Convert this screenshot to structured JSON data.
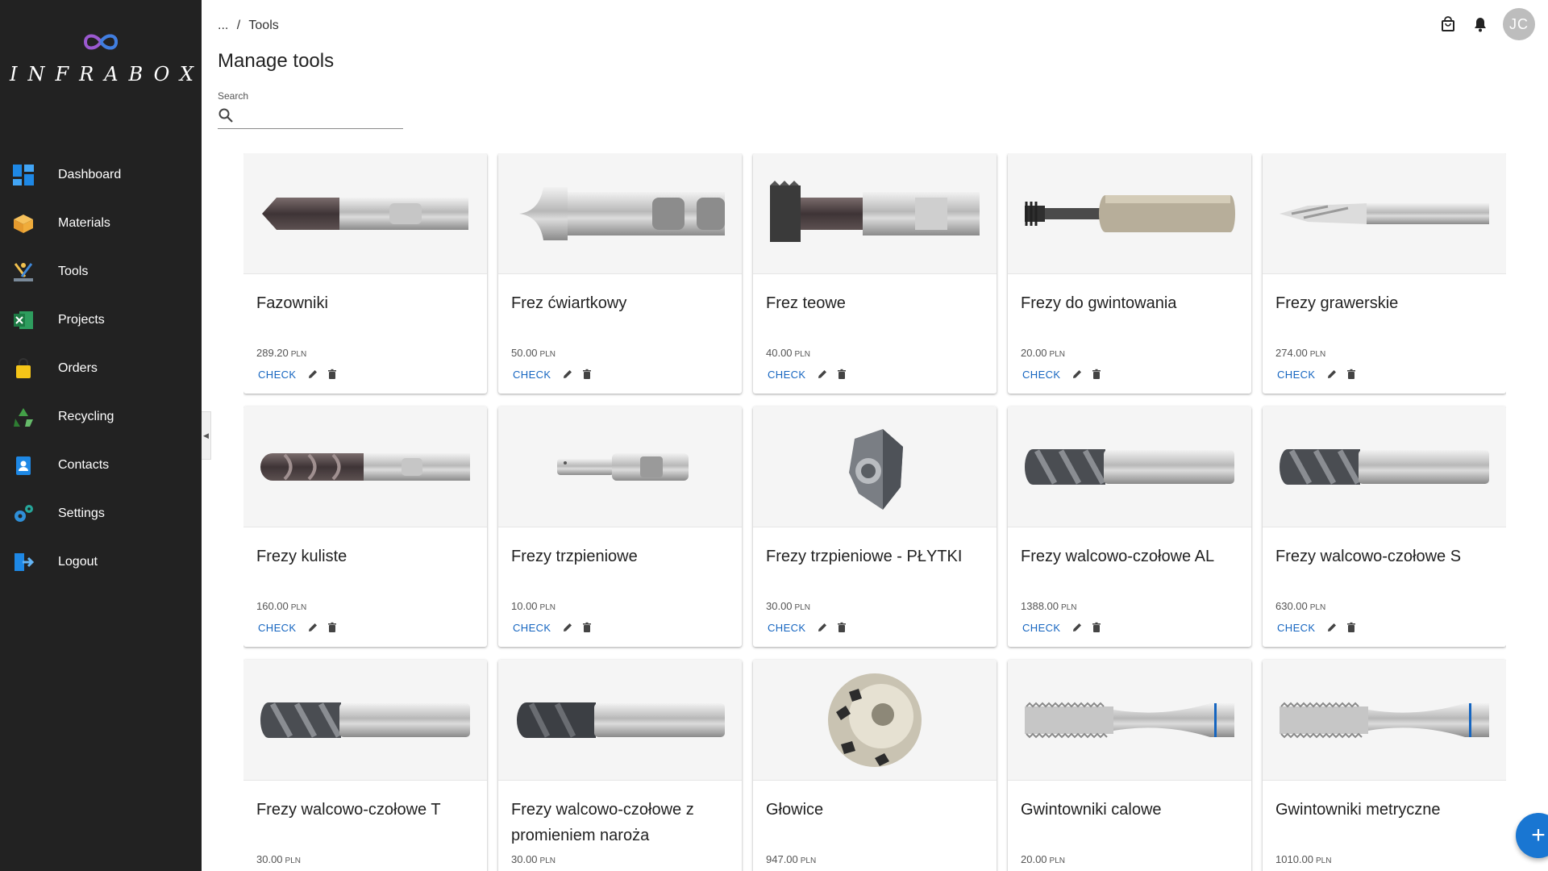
{
  "brand": {
    "name": "INFRABOX"
  },
  "sidebar": {
    "items": [
      {
        "label": "Dashboard",
        "icon": "dashboard-icon"
      },
      {
        "label": "Materials",
        "icon": "box-icon"
      },
      {
        "label": "Tools",
        "icon": "tools-icon"
      },
      {
        "label": "Projects",
        "icon": "spreadsheet-icon"
      },
      {
        "label": "Orders",
        "icon": "shopping-bag-icon"
      },
      {
        "label": "Recycling",
        "icon": "recycle-icon"
      },
      {
        "label": "Contacts",
        "icon": "contacts-icon"
      },
      {
        "label": "Settings",
        "icon": "gears-icon"
      },
      {
        "label": "Logout",
        "icon": "logout-icon"
      }
    ]
  },
  "header": {
    "breadcrumb_root": "...",
    "breadcrumb_sep": "/",
    "breadcrumb_current": "Tools",
    "title": "Manage tools",
    "avatar_initials": "JC"
  },
  "search": {
    "label": "Search",
    "value": ""
  },
  "card_actions": {
    "check_label": "CHECK",
    "currency": "PLN"
  },
  "tools": [
    {
      "name": "Fazowniki",
      "price": "289.20",
      "image": "chamfer-cutter"
    },
    {
      "name": "Frez ćwiartkowy",
      "price": "50.00",
      "image": "corner-rounding-cutter"
    },
    {
      "name": "Frez teowe",
      "price": "40.00",
      "image": "t-slot-cutter"
    },
    {
      "name": "Frezy do gwintowania",
      "price": "20.00",
      "image": "thread-mill"
    },
    {
      "name": "Frezy grawerskie",
      "price": "274.00",
      "image": "engraving-cutter"
    },
    {
      "name": "Frezy kuliste",
      "price": "160.00",
      "image": "ball-end-mill"
    },
    {
      "name": "Frezy trzpieniowe",
      "price": "10.00",
      "image": "shank-cutter"
    },
    {
      "name": "Frezy trzpieniowe - PŁYTKI",
      "price": "30.00",
      "image": "insert"
    },
    {
      "name": "Frezy walcowo-czołowe AL",
      "price": "1388.00",
      "image": "end-mill"
    },
    {
      "name": "Frezy walcowo-czołowe S",
      "price": "630.00",
      "image": "end-mill"
    },
    {
      "name": "Frezy walcowo-czołowe T",
      "price": "30.00",
      "image": "end-mill"
    },
    {
      "name": "Frezy walcowo-czołowe z promieniem naroża",
      "price": "30.00",
      "image": "radius-end-mill"
    },
    {
      "name": "Głowice",
      "price": "947.00",
      "image": "face-mill-head"
    },
    {
      "name": "Gwintowniki calowe",
      "price": "20.00",
      "image": "tap"
    },
    {
      "name": "Gwintowniki metryczne",
      "price": "1010.00",
      "image": "tap"
    }
  ],
  "colors": {
    "sidebar": "#222222",
    "accent": "#1565c0",
    "fab": "#1976d2"
  }
}
